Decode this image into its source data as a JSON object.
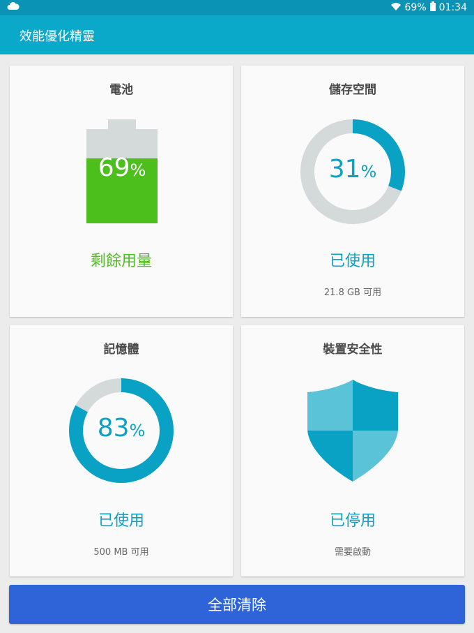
{
  "status_bar": {
    "battery_percent": "69%",
    "time": "01:34",
    "icons": [
      "cloud-icon",
      "wifi-icon",
      "battery-icon"
    ]
  },
  "app": {
    "title": "效能優化精靈"
  },
  "battery": {
    "title": "電池",
    "value": "69",
    "unit": "%",
    "level": 0.69,
    "status": "剩餘用量",
    "color": "#4cbf1c"
  },
  "storage": {
    "title": "儲存空間",
    "value": "31",
    "unit": "%",
    "level": 0.31,
    "status": "已使用",
    "detail": "21.8 GB 可用",
    "color": "#0aa2c4"
  },
  "memory": {
    "title": "記憶體",
    "value": "83",
    "unit": "%",
    "level": 0.83,
    "status": "已使用",
    "detail": "500 MB 可用",
    "color": "#0aa2c4"
  },
  "security": {
    "title": "裝置安全性",
    "status": "已停用",
    "detail": "需要啟動",
    "icon": "shield-icon"
  },
  "actions": {
    "clear_all": "全部清除"
  }
}
